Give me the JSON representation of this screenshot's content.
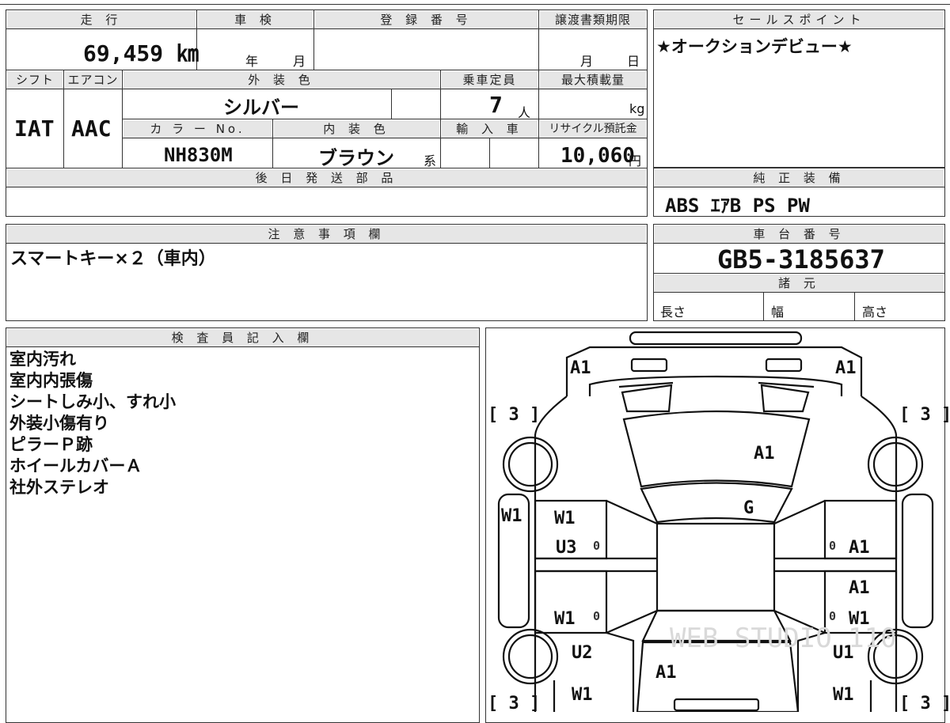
{
  "spec": {
    "mileage_label": "走 行",
    "mileage": "69,459 ㎞",
    "inspection_label": "車 検",
    "inspection_year": "年",
    "inspection_month": "月",
    "registration_label": "登 録 番 号",
    "transfer_deadline_label": "譲渡書類期限",
    "transfer_month": "月",
    "transfer_day": "日",
    "shift_label": "シフト",
    "shift": "IAT",
    "aircon_label": "エアコン",
    "aircon": "AAC",
    "exterior_color_label": "外 装 色",
    "exterior_color": "シルバー",
    "capacity_label": "乗車定員",
    "capacity": "7",
    "capacity_unit": "人",
    "max_load_label": "最大積載量",
    "max_load_unit": "kg",
    "color_no_label": "カ ラ ー No.",
    "color_no": "NH830M",
    "interior_color_label": "内 装 色",
    "interior_color": "ブラウン",
    "interior_suffix": "系",
    "import_label": "輸 入 車",
    "recycle_label": "リサイクル預託金",
    "recycle_fee": "10,060",
    "recycle_unit": "円",
    "later_parts_label": "後 日 発 送 部 品"
  },
  "sales_point": {
    "label": "セールスポイント",
    "text": "★オークションデビュー★"
  },
  "equipment": {
    "label": "純 正 装 備",
    "text": "ABS ｴｱB PS PW"
  },
  "caution": {
    "label": "注 意 事 項 欄",
    "text": "スマートキー×２（車内）"
  },
  "chassis": {
    "label": "車 台 番 号",
    "number": "GB5-3185637",
    "spec_label": "諸 元",
    "length_label": "長さ",
    "width_label": "幅",
    "height_label": "高さ"
  },
  "inspector": {
    "label": "検 査 員 記 入 欄",
    "notes": [
      "室内汚れ",
      "室内内張傷",
      "シートしみ小、すれ小",
      "外装小傷有り",
      "ピラーＰ跡",
      "ホイールカバーＡ",
      "社外ステレオ"
    ]
  },
  "diagram": {
    "tire_front_left": "[ 3 ]",
    "tire_front_right": "[ 3 ]",
    "tire_rear_left": "[ 3 ]",
    "tire_rear_right": "[ 3 ]",
    "front_left_corner": "A1",
    "front_right_corner": "A1",
    "hood": "A1",
    "windshield": "G",
    "left_side_panel": "W1",
    "front_left_door": "W1",
    "front_left_step": "U3",
    "rear_left_door": "W1",
    "rear_left_fender_u": "U2",
    "rear_left_fender_w": "W1",
    "front_right_door": "A1",
    "rear_right_door_a": "A1",
    "rear_right_door_w": "W1",
    "rear_right_fender_u": "U1",
    "rear_right_fender_w": "W1",
    "rear_glass": "A1",
    "zero_mark": "0",
    "watermark": "WEB STUDIO 110"
  }
}
